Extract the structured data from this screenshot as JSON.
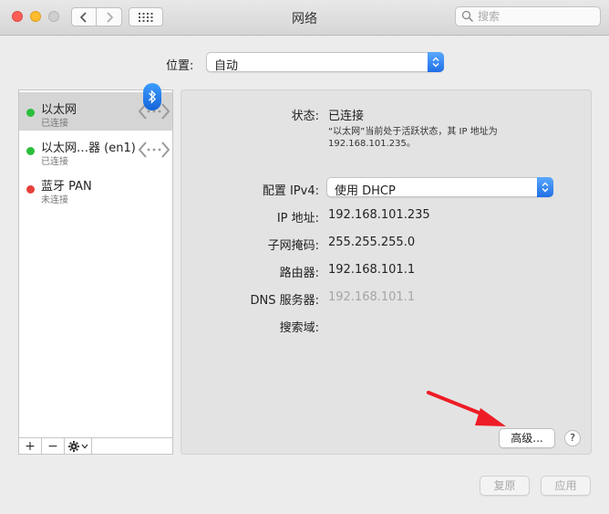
{
  "window": {
    "title": "网络"
  },
  "toolbar": {
    "search_placeholder": "搜索"
  },
  "location": {
    "label": "位置:",
    "value": "自动"
  },
  "sidebar": {
    "services": [
      {
        "name": "以太网",
        "status": "已连接",
        "dot_color": "#2bbe3c",
        "icon": "ethernet-icon"
      },
      {
        "name": "以太网…器 (en1)",
        "status": "已连接",
        "dot_color": "#2bbe3c",
        "icon": "ethernet-icon"
      },
      {
        "name": "蓝牙 PAN",
        "status": "未连接",
        "dot_color": "#e5403b",
        "icon": "bluetooth-icon"
      }
    ],
    "tools": {
      "add": "+",
      "remove": "−"
    }
  },
  "detail": {
    "status_label": "状态:",
    "status_value": "已连接",
    "status_desc": "“以太网”当前处于活跃状态，其 IP 地址为 192.168.101.235。",
    "configure_label": "配置 IPv4:",
    "configure_value": "使用 DHCP",
    "ip_label": "IP 地址:",
    "ip_value": "192.168.101.235",
    "subnet_label": "子网掩码:",
    "subnet_value": "255.255.255.0",
    "router_label": "路由器:",
    "router_value": "192.168.101.1",
    "dns_label": "DNS 服务器:",
    "dns_value": "192.168.101.1",
    "search_domain_label": "搜索域:",
    "advanced_button": "高级...",
    "help_button": "?"
  },
  "footer": {
    "revert": "复原",
    "apply": "应用"
  },
  "colors": {
    "accent": "#1f6fe6",
    "annotation_arrow": "#ee1c25"
  }
}
